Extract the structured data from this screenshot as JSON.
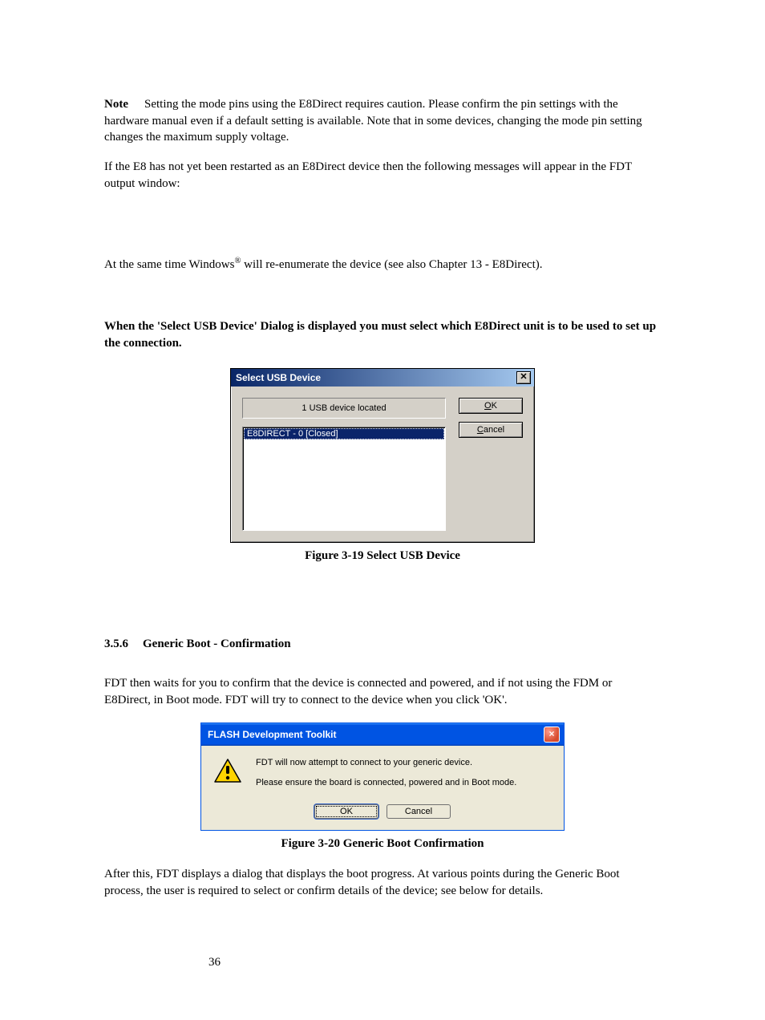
{
  "doc": {
    "note_label": "Note",
    "p1": "Setting the mode pins using the E8Direct requires caution. Please confirm the pin settings with the hardware manual even if a default setting is available. Note that in some devices, changing the mode pin setting changes the maximum supply voltage.",
    "p2": "If the E8 has not yet been restarted as an E8Direct device then the following messages will appear in the FDT output window:",
    "p3a": "At the same time Windows",
    "p3_sup": "®",
    "p3b": " will re-enumerate the device (see also Chapter 13 - E8Direct).",
    "p4": "When the 'Select USB Device' Dialog is displayed you must select which E8Direct unit is to be used to set up the connection.",
    "fig1": "Figure 3-19 Select USB Device",
    "sec_num": "3.5.6",
    "sec_title": "Generic Boot - Confirmation",
    "p5": "FDT then waits for you to confirm that the device is connected and powered, and if not using the FDM or E8Direct, in Boot mode. FDT will try to connect to the device when you click 'OK'.",
    "fig2": "Figure 3-20 Generic Boot Confirmation",
    "p6": "After this, FDT displays a dialog that displays the boot progress. At various points during the Generic Boot process, the user is required to select or confirm details of the device; see below for details.",
    "page_number": "36"
  },
  "dlg1": {
    "title": "Select USB Device",
    "close_glyph": "✕",
    "status_label": "1 USB device located",
    "list_item": "E8DIRECT - 0 [Closed]",
    "ok_u": "O",
    "ok_rest": "K",
    "cancel_u": "C",
    "cancel_rest": "ancel"
  },
  "dlg2": {
    "title": "FLASH Development Toolkit",
    "close_glyph": "×",
    "msg1": "FDT will now attempt to connect to your generic device.",
    "msg2": "Please ensure the board is connected, powered and in Boot mode.",
    "ok": "OK",
    "cancel": "Cancel"
  }
}
